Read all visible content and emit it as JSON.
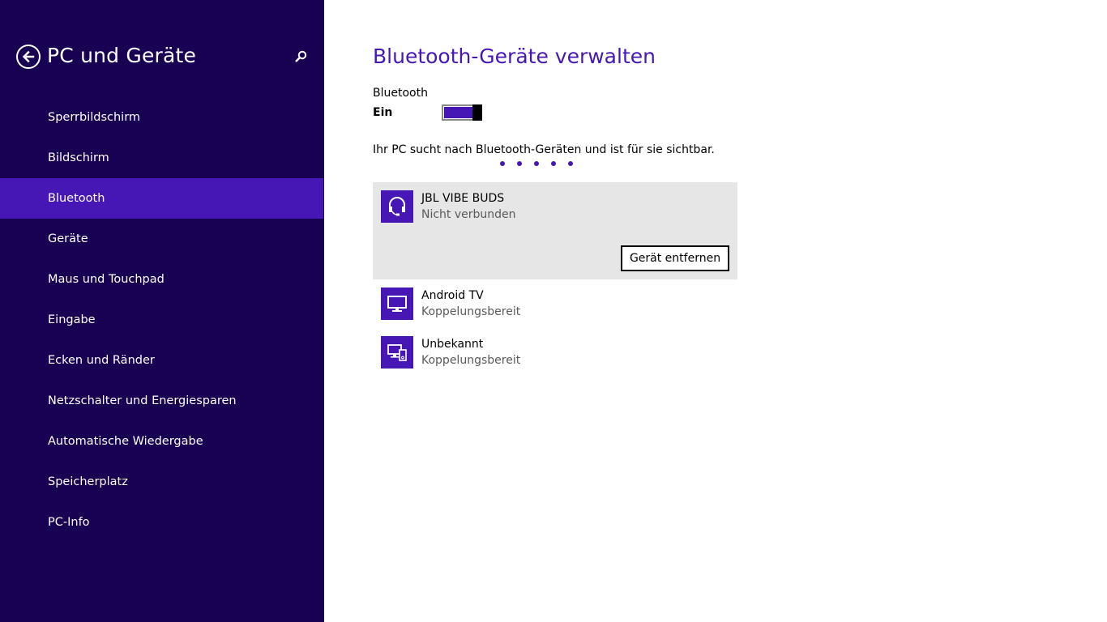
{
  "sidebar": {
    "title": "PC und Geräte",
    "back_icon": "back-arrow-icon",
    "search_icon": "search-icon",
    "items": [
      {
        "label": "Sperrbildschirm",
        "active": false
      },
      {
        "label": "Bildschirm",
        "active": false
      },
      {
        "label": "Bluetooth",
        "active": true
      },
      {
        "label": "Geräte",
        "active": false
      },
      {
        "label": "Maus und Touchpad",
        "active": false
      },
      {
        "label": "Eingabe",
        "active": false
      },
      {
        "label": "Ecken und Ränder",
        "active": false
      },
      {
        "label": "Netzschalter und Energiesparen",
        "active": false
      },
      {
        "label": "Automatische Wiedergabe",
        "active": false
      },
      {
        "label": "Speicherplatz",
        "active": false
      },
      {
        "label": "PC-Info",
        "active": false
      }
    ]
  },
  "main": {
    "title": "Bluetooth-Geräte verwalten",
    "bluetooth": {
      "label": "Bluetooth",
      "state_label": "Ein",
      "enabled": true
    },
    "status_text": "Ihr PC sucht nach Bluetooth-Geräten und ist für sie sichtbar.",
    "devices": [
      {
        "name": "JBL VIBE BUDS",
        "status": "Nicht verbunden",
        "icon": "headset-icon",
        "selected": true,
        "action_label": "Gerät entfernen"
      },
      {
        "name": "Android TV",
        "status": "Koppelungsbereit",
        "icon": "monitor-icon",
        "selected": false
      },
      {
        "name": "Unbekannt",
        "status": "Koppelungsbereit",
        "icon": "devices-icon",
        "selected": false
      }
    ]
  },
  "colors": {
    "sidebar_bg": "#180052",
    "accent": "#4617b4",
    "selected_bg": "#e6e6e6",
    "secondary_text": "#5a5a5a"
  }
}
